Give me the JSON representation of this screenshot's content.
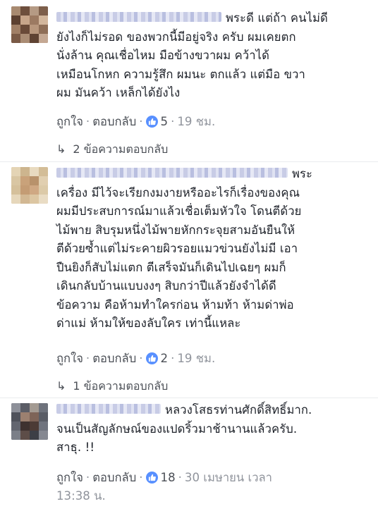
{
  "comments": [
    {
      "text": "พระดี แต่ถ้า คนไม่ดี\nยังไงก็ไม่รอด ของพวกนี้มีอยู่จริง ครับ ผมเคยตก\nนั่งล้าน คุณเชื่อไหม มือข้างขวาผม คว้าได้\nเหมือนโกหก ความรู้สึก ผมนะ ตกแล้ว แต่มือ ขวา\nผม มันคว้า เหล็กได้ยังไง",
      "like_label": "ถูกใจ",
      "reply_label": "ตอบกลับ",
      "like_count": "5",
      "time": "19 ชม.",
      "replies_label": "2 ข้อความตอบกลับ"
    },
    {
      "text": "พระ\nเครื่อง มีไว้จะเรียกงมงายหรืออะไรก็เรื่องของคุณ\nผมมีประสบการณ์มาแล้วเชื่อเต็มหัวใจ โดนตีด้วย\nไม้พาย สิบรุมหนึ่งไม้พายหักกระจุยสามอันยืนให้\nตีด้วยซ้ำแต่ไม่ระคายผิวรอยแมวข่วนยังไม่มี เอา\nปืนยิงก็สับไม่แตก ตีเสร็จมันก็เดินไปเฉยๆ ผมก็\nเดินกลับบ้านแบบงงๆ สิบกว่าปีแล้วยังจำได้ดี\nข้อความ คือห้ามทำใครก่อน ห้ามท้า ห้ามด่าพ่อ\nด่าแม่ ห้ามให้ของลับใคร เท่านี้แหละ",
      "like_label": "ถูกใจ",
      "reply_label": "ตอบกลับ",
      "like_count": "2",
      "time": "19 ชม.",
      "replies_label": "1 ข้อความตอบกลับ"
    },
    {
      "text": "หลวงโสธรท่านศักดิ์สิทธิ์มาก.\nจนเป็นสัญลักษณ์ของแปดริ้วมาช้านานแล้วครับ.\nสาธุ. !!",
      "like_label": "ถูกใจ",
      "reply_label": "ตอบกลับ",
      "like_count": "18",
      "time": "30 เมษายน เวลา",
      "time2": "13:38 น."
    }
  ],
  "icons": {
    "like": "thumbs-up-icon",
    "reply_arrow": "reply-arrow-icon"
  },
  "colors": {
    "link": "#4b4f56",
    "meta": "#90949c",
    "like_badge": "#5890ff"
  }
}
